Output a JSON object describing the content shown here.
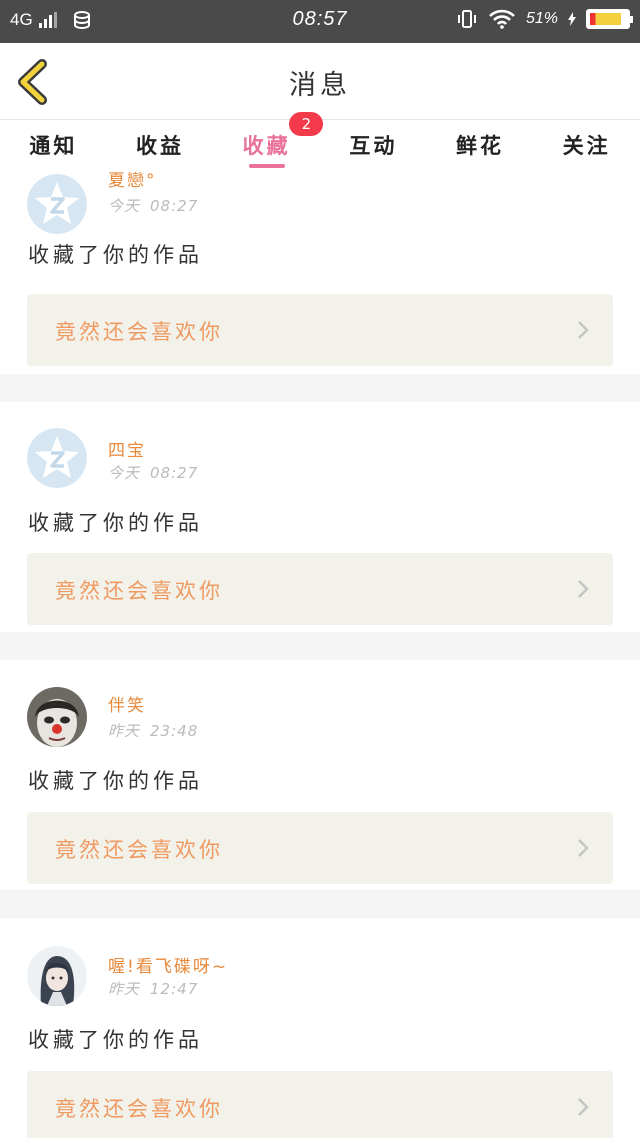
{
  "status_bar": {
    "network": "4G",
    "time": "08:57",
    "battery": "51%"
  },
  "header": {
    "title": "消息"
  },
  "tabs": [
    {
      "label": "通知"
    },
    {
      "label": "收益"
    },
    {
      "label": "收藏",
      "active": true,
      "badge": "2"
    },
    {
      "label": "互动"
    },
    {
      "label": "鲜花"
    },
    {
      "label": "关注"
    }
  ],
  "messages": [
    {
      "user": "夏戀°",
      "day": "今天",
      "time": "08:27",
      "action": "收藏了你的作品",
      "quote": "竟然还会喜欢你",
      "avatar": "qq-default-avatar"
    },
    {
      "user": "四宝",
      "day": "今天",
      "time": "08:27",
      "action": "收藏了你的作品",
      "quote": "竟然还会喜欢你",
      "avatar": "qq-default-avatar"
    },
    {
      "user": "伴笑",
      "day": "昨天",
      "time": "23:48",
      "action": "收藏了你的作品",
      "quote": "竟然还会喜欢你",
      "avatar": "clown-face-photo"
    },
    {
      "user": "喔!看飞碟呀~",
      "day": "昨天",
      "time": "12:47",
      "action": "收藏了你的作品",
      "quote": "竟然还会喜欢你",
      "avatar": "anime-girl-photo"
    }
  ],
  "colors": {
    "accent": "#e8729a",
    "username": "#e8893b",
    "quote_text": "#ef9a62",
    "quote_bg": "#f3f2ea",
    "badge": "#f23a4a",
    "status_bar": "#4a4a4a"
  }
}
